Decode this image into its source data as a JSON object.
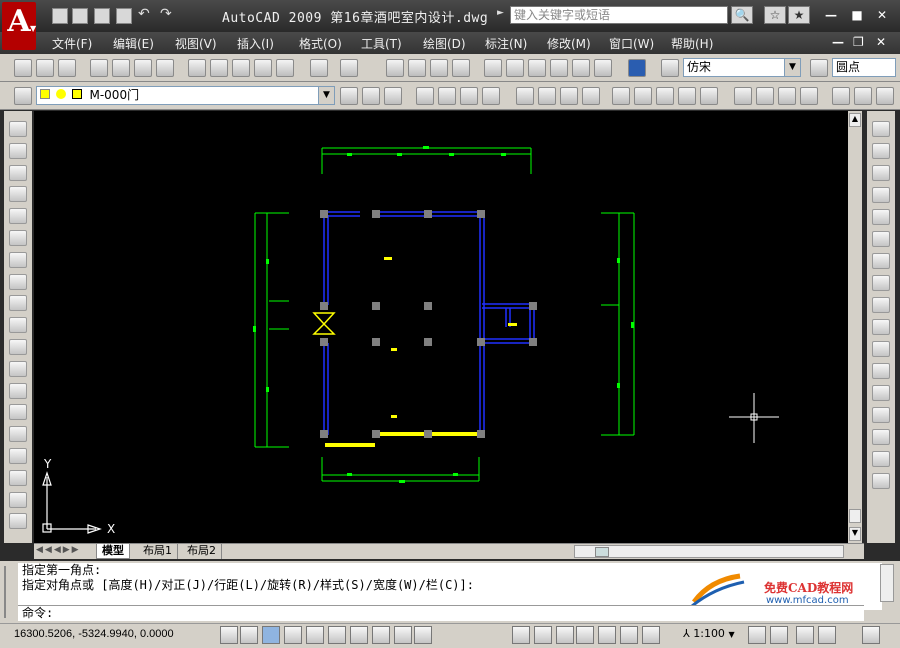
{
  "titlebar": {
    "title": "AutoCAD 2009  第16章酒吧室内设计.dwg",
    "search_placeholder": "键入关键字或短语",
    "app_letter": "A"
  },
  "menubar": {
    "items": [
      "文件(F)",
      "编辑(E)",
      "视图(V)",
      "插入(I)",
      "格式(O)",
      "工具(T)",
      "绘图(D)",
      "标注(N)",
      "修改(M)",
      "窗口(W)",
      "帮助(H)"
    ]
  },
  "toolbar": {
    "text_style": "仿宋",
    "dim_style": "圆点",
    "layer": "M-000门"
  },
  "canvas": {
    "ucs_y": "Y",
    "ucs_x": "X"
  },
  "tabs": [
    "模型",
    "布局1",
    "布局2"
  ],
  "command": {
    "history": [
      "指定第一角点:",
      "指定对角点或 [高度(H)/对正(J)/行距(L)/旋转(R)/样式(S)/宽度(W)/栏(C)]:"
    ],
    "prompt": "命令:",
    "watermark_title": "免费CAD教程网",
    "watermark_url": "www.mfcad.com"
  },
  "status": {
    "coords": "16300.5206, -5324.9940, 0.0000",
    "scale": "1:100"
  },
  "colors": {
    "wall_blue": "#1f2fff",
    "dim_green": "#00ff00",
    "highlight_yellow": "#ffff00",
    "grip_gray": "#808080",
    "canvas_bg": "#000000"
  }
}
